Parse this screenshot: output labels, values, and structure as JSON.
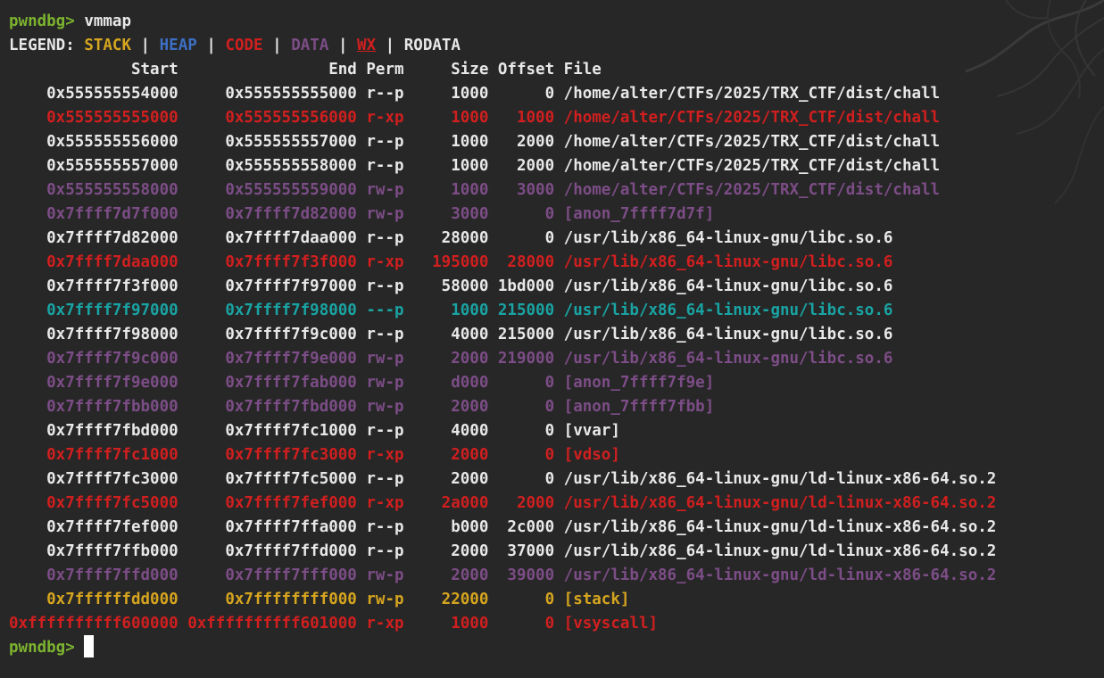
{
  "prompt": "pwndbg>",
  "command": "vmmap",
  "legend": {
    "label": "LEGEND:",
    "separator": "|",
    "items": [
      {
        "text": "STACK",
        "class": "c-stack"
      },
      {
        "text": "HEAP",
        "class": "c-heap"
      },
      {
        "text": "CODE",
        "class": "c-code"
      },
      {
        "text": "DATA",
        "class": "c-data"
      },
      {
        "text": "WX",
        "class": "c-wx"
      },
      {
        "text": "RODATA",
        "class": "c-rodata"
      }
    ]
  },
  "colors": {
    "background": "#272727",
    "prompt": "#7cb32f",
    "stack": "#d6a51f",
    "heap": "#3d6fc4",
    "code": "#d11f1f",
    "data": "#7c4d86",
    "rodata": "#e8e8e8",
    "no_access": "#1aa3a3"
  },
  "headers": {
    "start": "Start",
    "end": "End",
    "perm": "Perm",
    "size": "Size",
    "offset": "Offset",
    "file": "File"
  },
  "rows": [
    {
      "start": "0x555555554000",
      "end": "0x555555555000",
      "perm": "r--p",
      "size": "1000",
      "offset": "0",
      "file": "/home/alter/CTFs/2025/TRX_CTF/dist/chall",
      "type": "rodata"
    },
    {
      "start": "0x555555555000",
      "end": "0x555555556000",
      "perm": "r-xp",
      "size": "1000",
      "offset": "1000",
      "file": "/home/alter/CTFs/2025/TRX_CTF/dist/chall",
      "type": "code"
    },
    {
      "start": "0x555555556000",
      "end": "0x555555557000",
      "perm": "r--p",
      "size": "1000",
      "offset": "2000",
      "file": "/home/alter/CTFs/2025/TRX_CTF/dist/chall",
      "type": "rodata"
    },
    {
      "start": "0x555555557000",
      "end": "0x555555558000",
      "perm": "r--p",
      "size": "1000",
      "offset": "2000",
      "file": "/home/alter/CTFs/2025/TRX_CTF/dist/chall",
      "type": "rodata"
    },
    {
      "start": "0x555555558000",
      "end": "0x555555559000",
      "perm": "rw-p",
      "size": "1000",
      "offset": "3000",
      "file": "/home/alter/CTFs/2025/TRX_CTF/dist/chall",
      "type": "data"
    },
    {
      "start": "0x7ffff7d7f000",
      "end": "0x7ffff7d82000",
      "perm": "rw-p",
      "size": "3000",
      "offset": "0",
      "file": "[anon_7ffff7d7f]",
      "type": "data"
    },
    {
      "start": "0x7ffff7d82000",
      "end": "0x7ffff7daa000",
      "perm": "r--p",
      "size": "28000",
      "offset": "0",
      "file": "/usr/lib/x86_64-linux-gnu/libc.so.6",
      "type": "rodata"
    },
    {
      "start": "0x7ffff7daa000",
      "end": "0x7ffff7f3f000",
      "perm": "r-xp",
      "size": "195000",
      "offset": "28000",
      "file": "/usr/lib/x86_64-linux-gnu/libc.so.6",
      "type": "code"
    },
    {
      "start": "0x7ffff7f3f000",
      "end": "0x7ffff7f97000",
      "perm": "r--p",
      "size": "58000",
      "offset": "1bd000",
      "file": "/usr/lib/x86_64-linux-gnu/libc.so.6",
      "type": "rodata"
    },
    {
      "start": "0x7ffff7f97000",
      "end": "0x7ffff7f98000",
      "perm": "---p",
      "size": "1000",
      "offset": "215000",
      "file": "/usr/lib/x86_64-linux-gnu/libc.so.6",
      "type": "none"
    },
    {
      "start": "0x7ffff7f98000",
      "end": "0x7ffff7f9c000",
      "perm": "r--p",
      "size": "4000",
      "offset": "215000",
      "file": "/usr/lib/x86_64-linux-gnu/libc.so.6",
      "type": "rodata"
    },
    {
      "start": "0x7ffff7f9c000",
      "end": "0x7ffff7f9e000",
      "perm": "rw-p",
      "size": "2000",
      "offset": "219000",
      "file": "/usr/lib/x86_64-linux-gnu/libc.so.6",
      "type": "data"
    },
    {
      "start": "0x7ffff7f9e000",
      "end": "0x7ffff7fab000",
      "perm": "rw-p",
      "size": "d000",
      "offset": "0",
      "file": "[anon_7ffff7f9e]",
      "type": "data"
    },
    {
      "start": "0x7ffff7fbb000",
      "end": "0x7ffff7fbd000",
      "perm": "rw-p",
      "size": "2000",
      "offset": "0",
      "file": "[anon_7ffff7fbb]",
      "type": "data"
    },
    {
      "start": "0x7ffff7fbd000",
      "end": "0x7ffff7fc1000",
      "perm": "r--p",
      "size": "4000",
      "offset": "0",
      "file": "[vvar]",
      "type": "rodata"
    },
    {
      "start": "0x7ffff7fc1000",
      "end": "0x7ffff7fc3000",
      "perm": "r-xp",
      "size": "2000",
      "offset": "0",
      "file": "[vdso]",
      "type": "code"
    },
    {
      "start": "0x7ffff7fc3000",
      "end": "0x7ffff7fc5000",
      "perm": "r--p",
      "size": "2000",
      "offset": "0",
      "file": "/usr/lib/x86_64-linux-gnu/ld-linux-x86-64.so.2",
      "type": "rodata"
    },
    {
      "start": "0x7ffff7fc5000",
      "end": "0x7ffff7fef000",
      "perm": "r-xp",
      "size": "2a000",
      "offset": "2000",
      "file": "/usr/lib/x86_64-linux-gnu/ld-linux-x86-64.so.2",
      "type": "code"
    },
    {
      "start": "0x7ffff7fef000",
      "end": "0x7ffff7ffa000",
      "perm": "r--p",
      "size": "b000",
      "offset": "2c000",
      "file": "/usr/lib/x86_64-linux-gnu/ld-linux-x86-64.so.2",
      "type": "rodata"
    },
    {
      "start": "0x7ffff7ffb000",
      "end": "0x7ffff7ffd000",
      "perm": "r--p",
      "size": "2000",
      "offset": "37000",
      "file": "/usr/lib/x86_64-linux-gnu/ld-linux-x86-64.so.2",
      "type": "rodata"
    },
    {
      "start": "0x7ffff7ffd000",
      "end": "0x7ffff7fff000",
      "perm": "rw-p",
      "size": "2000",
      "offset": "39000",
      "file": "/usr/lib/x86_64-linux-gnu/ld-linux-x86-64.so.2",
      "type": "data"
    },
    {
      "start": "0x7ffffffdd000",
      "end": "0x7ffffffff000",
      "perm": "rw-p",
      "size": "22000",
      "offset": "0",
      "file": "[stack]",
      "type": "stack"
    },
    {
      "start": "0xffffffffff600000",
      "end": "0xffffffffff601000",
      "perm": "r-xp",
      "size": "1000",
      "offset": "0",
      "file": "[vsyscall]",
      "type": "code"
    }
  ]
}
